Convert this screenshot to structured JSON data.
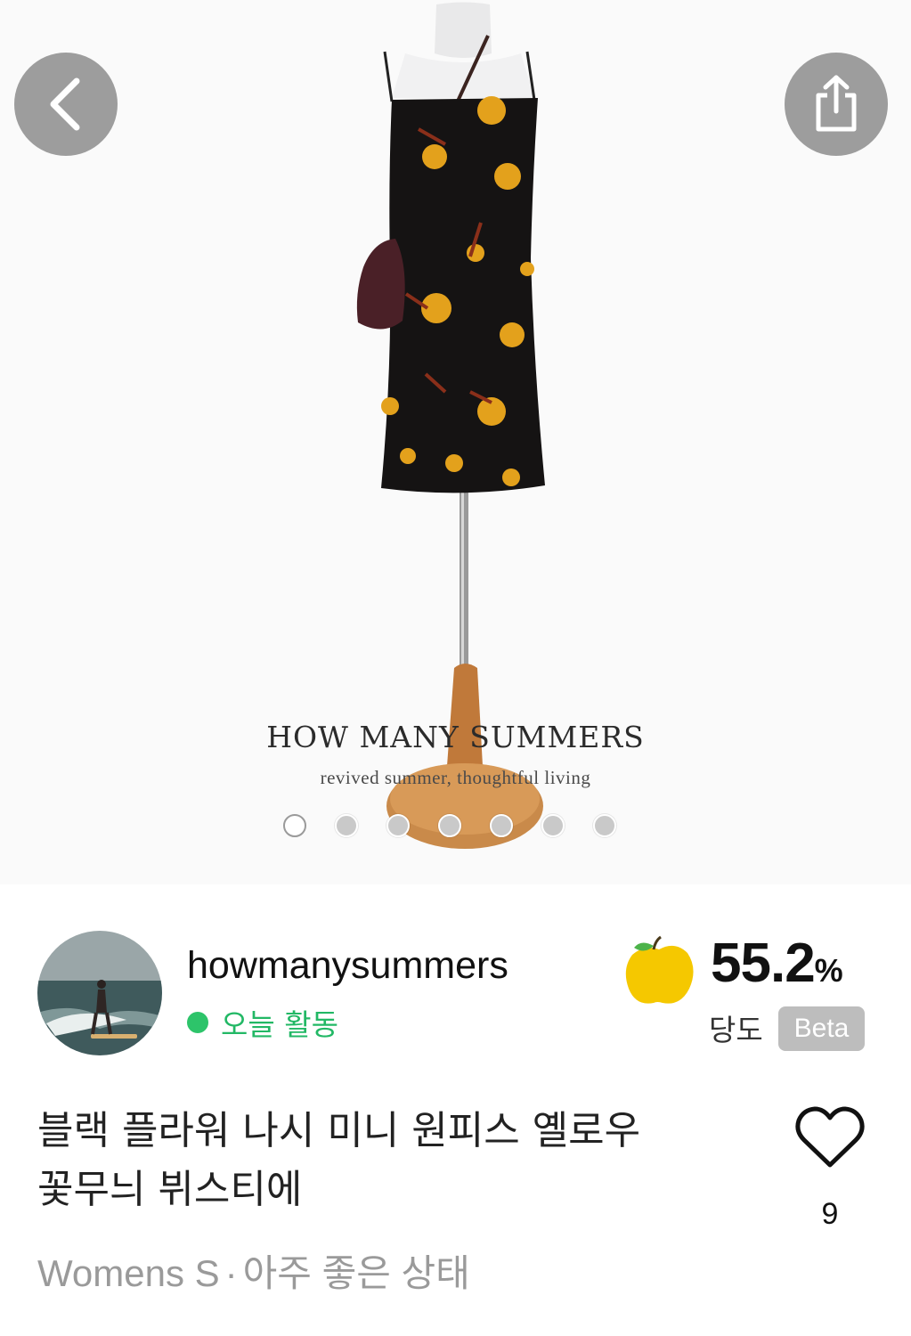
{
  "hero": {
    "brand_name": "HOW MANY SUMMERS",
    "brand_tagline": "revived summer, thoughtful living",
    "image_count": 7,
    "active_image_index": 0
  },
  "icons": {
    "back": "chevron-left-icon",
    "share": "share-icon",
    "fruit": "apple-icon",
    "like": "heart-icon"
  },
  "seller": {
    "name": "howmanysummers",
    "activity": "오늘 활동",
    "activity_color": "#2dc46a"
  },
  "sweetness": {
    "value": "55.2",
    "unit": "%",
    "label": "당도",
    "badge": "Beta",
    "fruit_color": "#f5c800"
  },
  "product": {
    "title_line1": "블랙 플라워 나시 미니 원피스 옐로우",
    "title_line2": "꽃무늬 뷔스티에",
    "size": "Womens S",
    "separator": "·",
    "condition": "아주 좋은 상태",
    "like_count": "9"
  }
}
